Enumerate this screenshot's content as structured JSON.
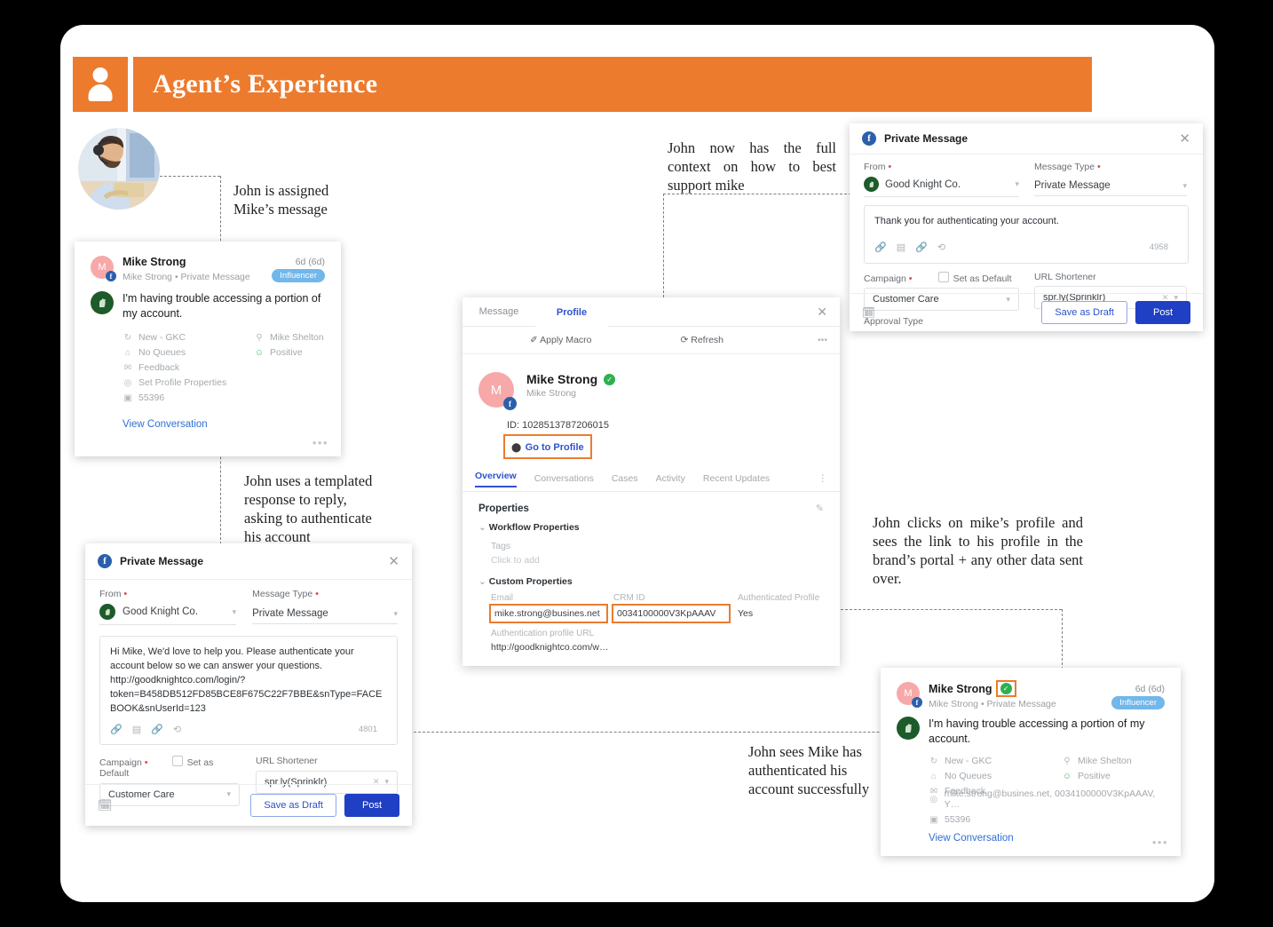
{
  "header": {
    "title": "Agent’s Experience",
    "icon": "person-icon",
    "accent": "#ec7b2e"
  },
  "notes": {
    "assigned": "John is assigned\nMike’s message",
    "templated": "John uses a templated\nresponse to reply,\nasking to authenticate\nhis account",
    "context": "John now has the full context on how to best support mike",
    "profile": "John clicks on mike’s profile and sees the link to his profile in the brand’s portal + any other data sent over.",
    "authenticated": "John sees Mike has\nauthenticated his\naccount successfully"
  },
  "message_card": {
    "avatar_initial": "M",
    "name": "Mike Strong",
    "subtitle": "Mike Strong • Private Message",
    "time": "6d  (6d)",
    "badge": "Influencer",
    "body": "I'm having trouble accessing a portion of my account.",
    "meta_left": [
      {
        "icon": "status-icon",
        "label": "New - GKC"
      },
      {
        "icon": "queue-icon",
        "label": "No Queues"
      },
      {
        "icon": "mail-icon",
        "label": "Feedback"
      },
      {
        "icon": "profile-icon",
        "label": "Set Profile Properties"
      },
      {
        "icon": "id-icon",
        "label": "55396"
      }
    ],
    "meta_right": [
      {
        "icon": "user-icon",
        "label": "Mike Shelton"
      },
      {
        "icon": "sentiment-icon",
        "label": "Positive"
      }
    ],
    "link": "View Conversation",
    "more": "•••"
  },
  "message_card_auth": {
    "avatar_initial": "M",
    "name": "Mike Strong",
    "verified": "verified-badge",
    "subtitle": "Mike Strong • Private Message",
    "time": "6d  (6d)",
    "badge": "Influencer",
    "body": "I'm having trouble accessing a portion of my account.",
    "meta_left": [
      {
        "icon": "status-icon",
        "label": "New - GKC"
      },
      {
        "icon": "queue-icon",
        "label": "No Queues"
      },
      {
        "icon": "mail-icon",
        "label": "Feedback"
      },
      {
        "icon": "profile-icon",
        "label": "mike.strong@busines.net, 0034100000V3KpAAAV, Y…"
      },
      {
        "icon": "id-icon",
        "label": "55396"
      }
    ],
    "meta_right": [
      {
        "icon": "user-icon",
        "label": "Mike Shelton"
      },
      {
        "icon": "sentiment-icon",
        "label": "Positive"
      }
    ],
    "link": "View Conversation",
    "more": "•••"
  },
  "compose_left": {
    "title": "Private Message",
    "close": "✕",
    "from_label": "From",
    "from_value": "Good Knight Co.",
    "type_label": "Message Type",
    "type_value": "Private Message",
    "body": "Hi Mike, We'd love to help you. Please authenticate your account below so we can answer your questions. http://goodknightco.com/login/?token=B458DB512FD85BCE8F675C22F7BBE&snType=FACEBOOK&snUserId=123",
    "char_count": "4801",
    "campaign_label": "Campaign",
    "campaign_value": "Customer Care",
    "set_default": "Set as Default",
    "shortener_label": "URL Shortener",
    "shortener_value": "spr.ly(Sprinklr)",
    "save_draft": "Save as Draft",
    "post": "Post"
  },
  "compose_right": {
    "title": "Private Message",
    "close": "✕",
    "from_label": "From",
    "from_value": "Good Knight Co.",
    "type_label": "Message Type",
    "type_value": "Private Message",
    "body": "Thank you for authenticating your account.",
    "char_count": "4958",
    "campaign_label": "Campaign",
    "campaign_value": "Customer Care",
    "set_default": "Set as Default",
    "shortener_label": "URL Shortener",
    "shortener_value": "spr.ly(Sprinklr)",
    "approval_label": "Approval Type",
    "save_draft": "Save as Draft",
    "post": "Post"
  },
  "profile_panel": {
    "tab_message": "Message",
    "tab_profile": "Profile",
    "close": "✕",
    "apply_macro": "Apply Macro",
    "refresh": "Refresh",
    "more": "•••",
    "name": "Mike Strong",
    "handle": "Mike Strong",
    "avatar_initial": "M",
    "id": "ID: 1028513787206015",
    "go_to_profile": "Go to Profile",
    "tabs": [
      "Overview",
      "Conversations",
      "Cases",
      "Activity",
      "Recent Updates"
    ],
    "properties_title": "Properties",
    "workflow_section": "Workflow Properties",
    "tags_label": "Tags",
    "tags_placeholder": "Click to add",
    "custom_section": "Custom Properties",
    "email_label": "Email",
    "email_value": "mike.strong@busines.net",
    "crm_label": "CRM ID",
    "crm_value": "0034100000V3KpAAAV",
    "auth_label": "Authenticated Profile",
    "auth_value": "Yes",
    "auth_url_label": "Authentication profile URL",
    "auth_url_value": "http://goodknightco.com/w…"
  }
}
